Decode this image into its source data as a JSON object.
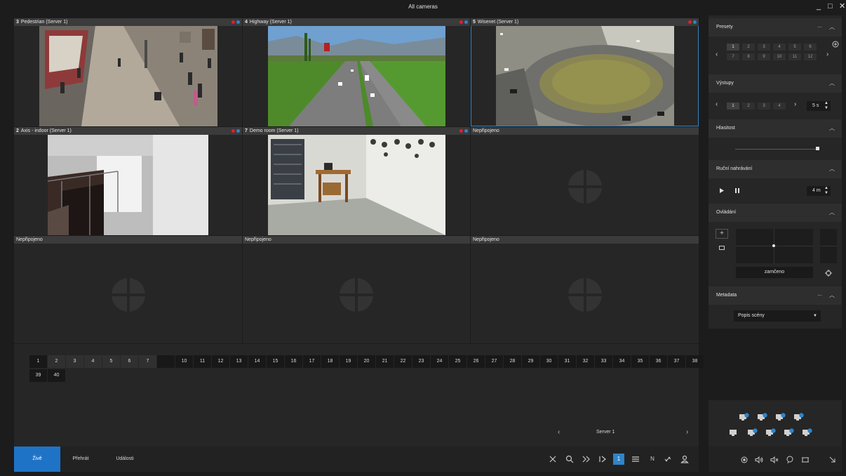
{
  "window": {
    "title": "All cameras",
    "min_label": "_",
    "max_label": "□",
    "close_label": "✕"
  },
  "tiles": [
    {
      "num": "3",
      "label": "Pedestrian (Server 1)",
      "state": "live",
      "scene": "pedestrian"
    },
    {
      "num": "4",
      "label": "Highway (Server 1)",
      "state": "live",
      "scene": "highway"
    },
    {
      "num": "5",
      "label": "Wisenet (Server 1)",
      "state": "live",
      "scene": "roundabout",
      "selected": true
    },
    {
      "num": "2",
      "label": "Axis - indoor (Server 1)",
      "state": "live",
      "scene": "stairs"
    },
    {
      "num": "7",
      "label": "Demo room (Server 1)",
      "state": "live",
      "scene": "room"
    },
    {
      "num": "",
      "label": "Nepřipojeno",
      "state": "empty"
    },
    {
      "num": "",
      "label": "Nepřipojeno",
      "state": "empty"
    },
    {
      "num": "",
      "label": "Nepřipojeno",
      "state": "empty"
    },
    {
      "num": "",
      "label": "Nepřipojeno",
      "state": "empty"
    }
  ],
  "layout_numbers": [
    "1",
    "2",
    "3",
    "4",
    "5",
    "6",
    "7",
    "",
    "10",
    "11",
    "12",
    "13",
    "14",
    "15",
    "16",
    "17",
    "18",
    "19",
    "20",
    "21",
    "22",
    "23",
    "24",
    "25",
    "26",
    "27",
    "28",
    "29",
    "30",
    "31",
    "32",
    "33",
    "34",
    "35",
    "36",
    "37",
    "38",
    "39",
    "40"
  ],
  "server_nav": {
    "label": "Server 1",
    "prev": "‹",
    "next": "›"
  },
  "tabs": [
    {
      "label": "Živě",
      "active": true
    },
    {
      "label": "Přehrát",
      "active": false
    },
    {
      "label": "Události",
      "active": false
    }
  ],
  "toolbar_icons": [
    "close-icon",
    "search-icon",
    "fast-forward-icon",
    "step-play-icon",
    "single-view-icon",
    "menu-icon",
    "n-icon",
    "link-icon",
    "user-icon"
  ],
  "toolbar_labels": {
    "single_view": "1",
    "n": "N"
  },
  "panel": {
    "presets": {
      "title": "Presety",
      "dots": "...",
      "values": [
        "1",
        "2",
        "3",
        "4",
        "5",
        "6",
        "7",
        "8",
        "9",
        "10",
        "11",
        "12"
      ]
    },
    "outputs": {
      "title": "Výstupy",
      "values": [
        "1",
        "2",
        "3",
        "4"
      ],
      "interval": "5 s"
    },
    "volume": {
      "title": "Hlasitost",
      "level": 0.98
    },
    "manual_recording": {
      "title": "Ruční nahrávání",
      "duration": "4 m"
    },
    "control": {
      "title": "Ovládání",
      "lock_label": "zamčeno",
      "plus": "+"
    },
    "metadata": {
      "title": "Metadata",
      "dots": "...",
      "select_value": "Popis scény"
    }
  },
  "colors": {
    "accent": "#1f73c7",
    "rec_red": "#e0202a",
    "rec_blue": "#2f84c9",
    "tile_header": "#3b3b3b"
  }
}
